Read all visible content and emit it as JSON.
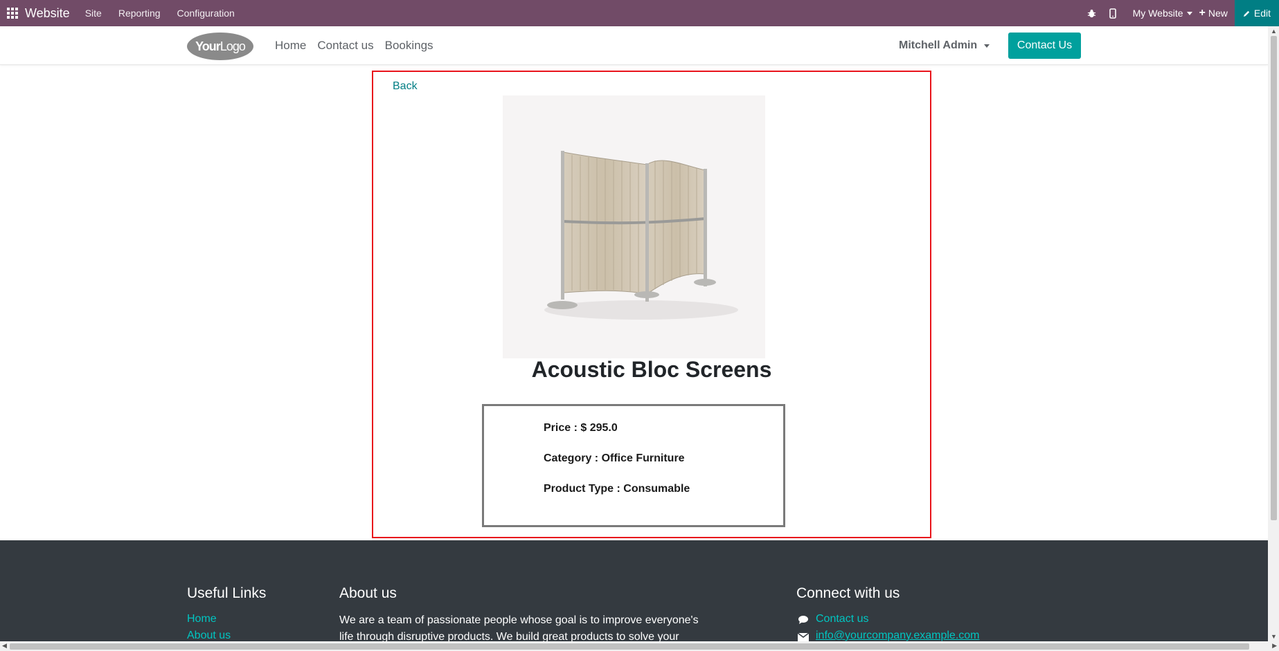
{
  "topbar": {
    "brand": "Website",
    "menus": [
      "Site",
      "Reporting",
      "Configuration"
    ],
    "my_website": "My Website",
    "new_label": "New",
    "edit_label": "Edit"
  },
  "header": {
    "logo_bold": "Your",
    "logo_light": "Logo",
    "nav": [
      "Home",
      "Contact us",
      "Bookings"
    ],
    "user": "Mitchell Admin",
    "contact_button": "Contact Us"
  },
  "product": {
    "back": "Back",
    "name": "Acoustic Bloc Screens",
    "price": "Price : $ 295.0",
    "category": "Category : Office Furniture",
    "product_type": "Product Type : Consumable"
  },
  "footer": {
    "useful_links_title": "Useful Links",
    "useful_links": [
      "Home",
      "About us"
    ],
    "about_title": "About us",
    "about_text": "We are a team of passionate people whose goal is to improve everyone's life through disruptive products. We build great products to solve your",
    "connect_title": "Connect with us",
    "connect_links": [
      "Contact us",
      "info@yourcompany.example.com"
    ]
  },
  "colors": {
    "topbar": "#714B67",
    "edit": "#017E84",
    "primary": "#00A09D",
    "card_border": "#e8141b",
    "footer": "#343a40"
  }
}
